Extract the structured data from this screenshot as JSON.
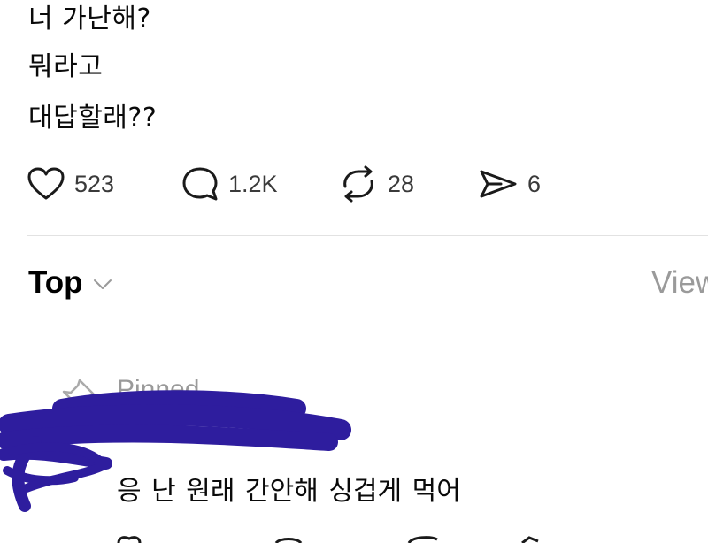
{
  "post": {
    "lines": [
      "너 가난해?",
      "뭐라고",
      "대답할래??"
    ]
  },
  "actions": {
    "likes": "523",
    "comments": "1.2K",
    "reposts": "28",
    "shares": "6"
  },
  "replies_header": {
    "sort_label": "Top",
    "view_label": "View"
  },
  "pinned_reply": {
    "pinned_label": "Pinned",
    "body": "응 난 원래 간안해  싱겁게 먹어"
  },
  "colors": {
    "scribble": "#2e1d9e",
    "muted": "#9a9a9a",
    "divider": "#e2e2e2"
  }
}
